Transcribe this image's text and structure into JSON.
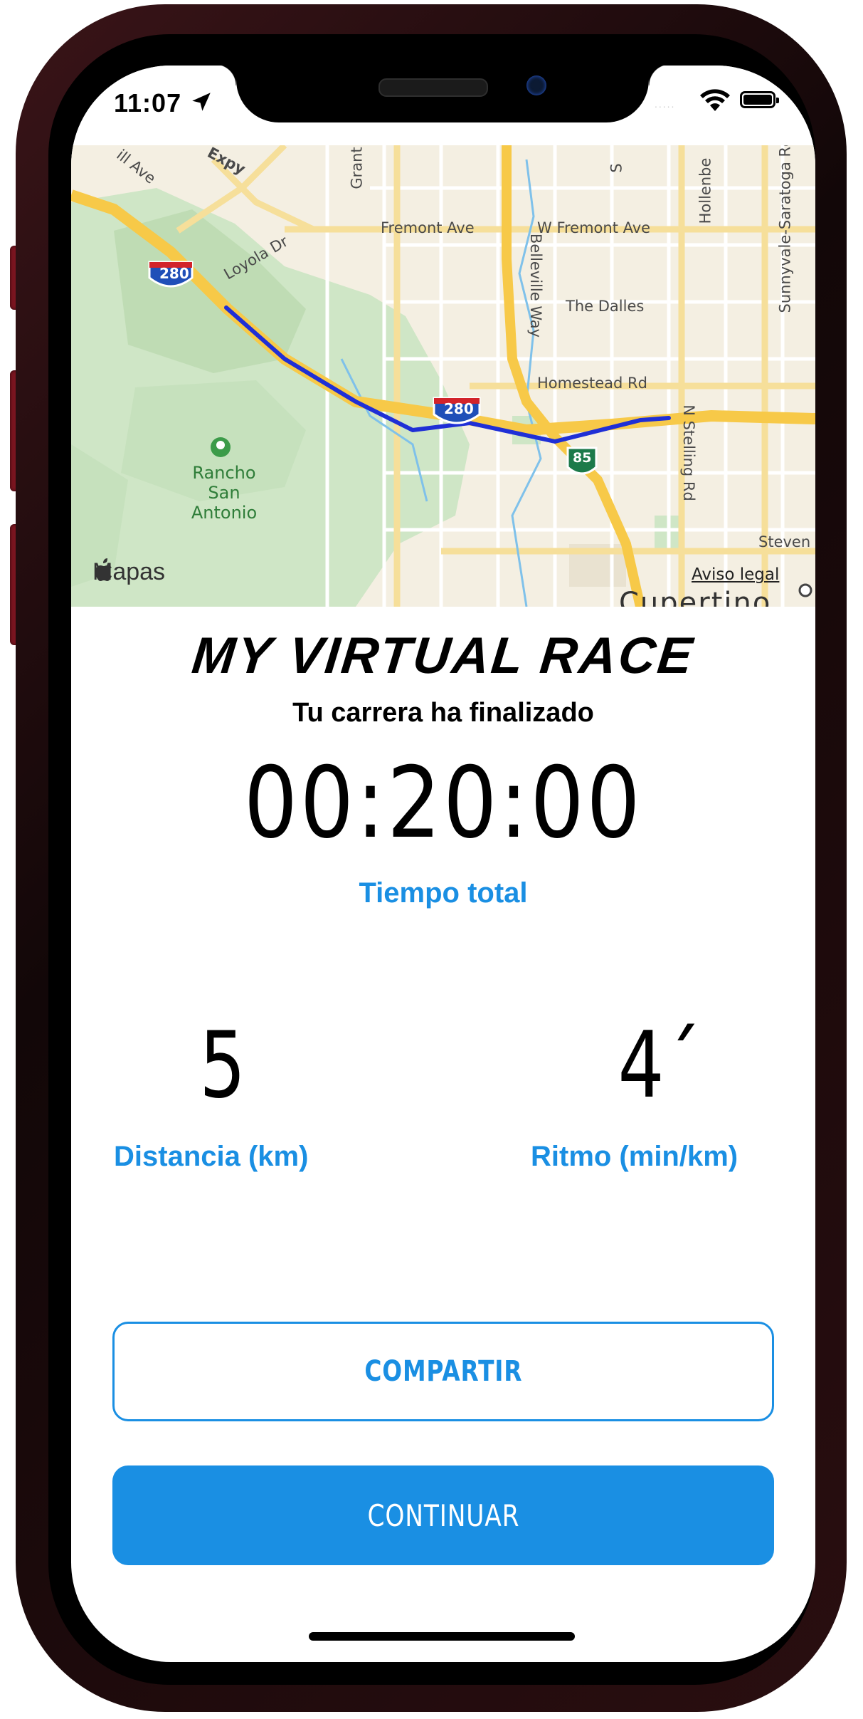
{
  "status_bar": {
    "time": "11:07",
    "location_icon": "location-arrow-icon",
    "wifi_icon": "wifi-icon",
    "battery_icon": "battery-icon",
    "signal_dots": "....."
  },
  "map": {
    "brand": "Mapas",
    "legal": "Aviso legal",
    "labels": {
      "grant": "Grant",
      "expy": "Expy",
      "ave_top": "ill Ave",
      "fremont": "Fremont Ave",
      "w_fremont": "W Fremont Ave",
      "loyola": "Loyola Dr",
      "belleville": "Belleville Way",
      "the_dalles": "The Dalles",
      "homestead": "Homestead Rd",
      "stelling": "N Stelling Rd",
      "hollenbeck": "Hollenbe",
      "saratoga": "Sunnyvale-Saratoga Rd",
      "s_label": "S",
      "park": "Rancho San Antonio",
      "stevens": "Steven",
      "cupertino": "Cupertino",
      "i280_a": "280",
      "i280_b": "280",
      "ca85": "85"
    },
    "route_color": "#1f2fd6",
    "highway_color": "#f7c948"
  },
  "race": {
    "title": "MY VIRTUAL RACE",
    "subtitle": "Tu carrera ha finalizado",
    "total_time": "00:20:00",
    "total_time_label": "Tiempo total",
    "distance_value": "5",
    "distance_label": "Distancia (km)",
    "pace_value": "4´",
    "pace_label": "Ritmo (min/km)"
  },
  "buttons": {
    "share": "COMPARTIR",
    "continue": "CONTINUAR"
  },
  "colors": {
    "accent": "#1a8fe3",
    "text": "#000000",
    "phone_frame": "#3a1418"
  }
}
